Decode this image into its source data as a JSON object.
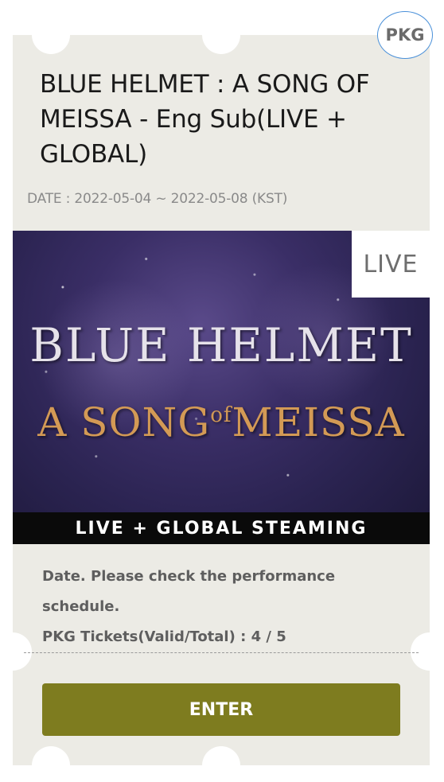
{
  "badge": {
    "label": "PKG"
  },
  "ticket": {
    "title": "BLUE HELMET : A SONG OF MEISSA - Eng Sub(LIVE + GLOBAL)",
    "date_text": "DATE : 2022-05-04 ~ 2022-05-08 (KST)"
  },
  "poster": {
    "live_tag": "LIVE",
    "line1": "BLUE HELMET",
    "line2_a": "A SONG",
    "line2_of": "of",
    "line2_b": "MEISSA",
    "banner": "LIVE + GLOBAL STEAMING"
  },
  "info": {
    "date_note": "Date. Please check the performance schedule.",
    "pkg_tickets": "PKG Tickets(Valid/Total) : 4 / 5"
  },
  "actions": {
    "enter_label": "ENTER"
  },
  "colors": {
    "ticket_bg": "#ecebe5",
    "button_bg": "#7e7c1f",
    "badge_border": "#4a90d9"
  }
}
